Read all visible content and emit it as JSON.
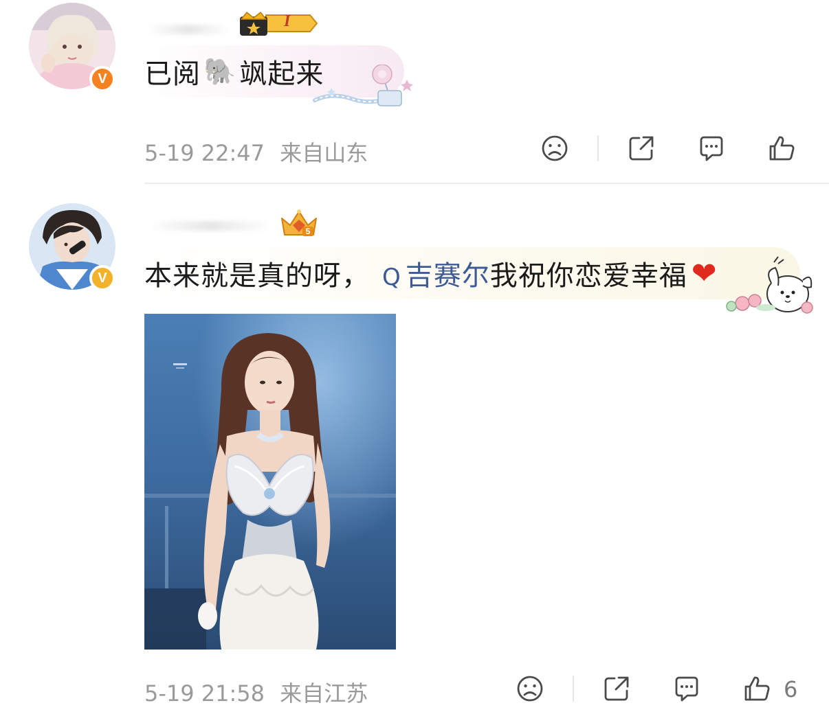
{
  "comments": [
    {
      "badge_text": "I",
      "text_before": "已阅",
      "emoji": "🐘",
      "text_after": "飒起来",
      "timestamp": "5-19 22:47",
      "location": "来自山东",
      "like_count": ""
    },
    {
      "text_before": "本来就是真的呀，",
      "search_glyph": "Q",
      "link_text": "吉赛尔",
      "text_after": "我祝你恋爱幸福",
      "emoji": "❤",
      "timestamp": "5-19 21:58",
      "location": "来自江苏",
      "like_count": "6"
    }
  ],
  "icons": [
    "sad-face-icon",
    "share-icon",
    "comment-icon",
    "thumbs-up-icon",
    "verified-badge-icon",
    "crown-badge-icon"
  ],
  "colors": {
    "link": "#3d5a95",
    "meta_text": "#9a9a9a",
    "verified_orange": "#f5821f",
    "verified_gold": "#f2b32a"
  }
}
